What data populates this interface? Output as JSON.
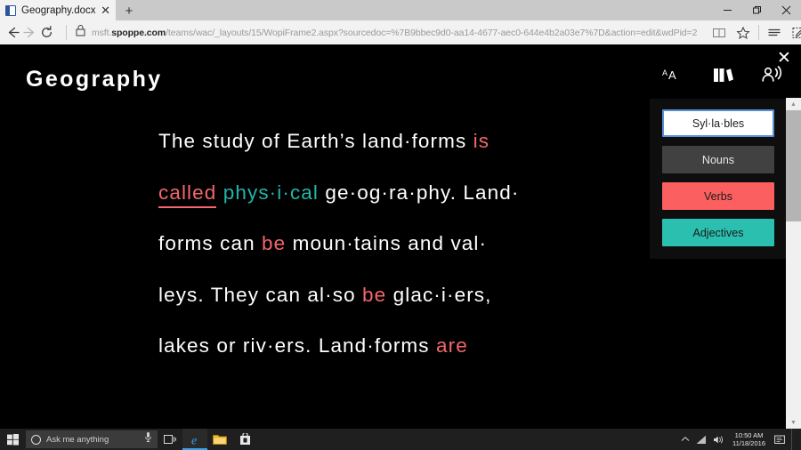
{
  "browser": {
    "tab": {
      "title": "Geography.docx",
      "favicon_icon": "word-doc-icon",
      "close_icon": "close-icon"
    },
    "new_tab_label": "+",
    "window_controls": {
      "minimize": "minimize-icon",
      "restore": "restore-icon",
      "close": "close-icon"
    },
    "nav": {
      "back_icon": "back-arrow-icon",
      "forward_icon": "forward-arrow-icon",
      "refresh_icon": "refresh-icon",
      "lock_icon": "lock-icon"
    },
    "address": {
      "prefix": "msft.",
      "domain": "spoppe.com",
      "path": "/teams/wac/_layouts/15/WopiFrame2.aspx?sourcedoc=%7B9bbec9d0-aa14-4677-aec0-644e4b2a03e7%7D&action=edit&wdPid=2"
    },
    "toolbar_icons": [
      "reading-view-icon",
      "favorites-star-icon",
      "reading-list-icon",
      "web-notes-icon",
      "share-icon",
      "office-icon",
      "more-icon"
    ]
  },
  "reader": {
    "close_label": "✕",
    "title": "Geography",
    "lines": [
      {
        "id": 1,
        "parts": [
          {
            "text": "The study of Earth’s land·forms ",
            "kind": "plain"
          },
          {
            "text": "is",
            "kind": "verb"
          }
        ]
      },
      {
        "id": 2,
        "parts": [
          {
            "text": "called",
            "kind": "verb-selected"
          },
          {
            "text": " ",
            "kind": "plain"
          },
          {
            "text": "phys·i·cal",
            "kind": "adjective"
          },
          {
            "text": " ge·og·ra·phy. Land·",
            "kind": "plain"
          }
        ]
      },
      {
        "id": 3,
        "parts": [
          {
            "text": "forms can ",
            "kind": "plain"
          },
          {
            "text": "be",
            "kind": "verb"
          },
          {
            "text": " moun·tains and val·",
            "kind": "plain"
          }
        ]
      },
      {
        "id": 4,
        "parts": [
          {
            "text": "leys. They can al·so ",
            "kind": "plain"
          },
          {
            "text": "be",
            "kind": "verb"
          },
          {
            "text": " glac·i·ers,",
            "kind": "plain"
          }
        ]
      },
      {
        "id": 5,
        "parts": [
          {
            "text": "lakes or riv·ers. Land·forms ",
            "kind": "plain"
          },
          {
            "text": "are",
            "kind": "verb"
          }
        ]
      }
    ],
    "play_button_icon": "play-icon",
    "tool_icons": [
      {
        "name": "text-size-icon",
        "glyph": "AA"
      },
      {
        "name": "grammar-tools-icon",
        "glyph": "books"
      },
      {
        "name": "read-aloud-icon",
        "glyph": "person-speaking"
      }
    ],
    "options": [
      {
        "label": "Syl·la·bles",
        "state": "selected",
        "color": "#ffffff"
      },
      {
        "label": "Nouns",
        "state": "off",
        "color": "#414141"
      },
      {
        "label": "Verbs",
        "state": "on",
        "color": "#fb5f5f"
      },
      {
        "label": "Adjectives",
        "state": "on",
        "color": "#2bbfb0"
      }
    ],
    "scrollbar": {
      "up_icon": "scroll-up-icon",
      "down_icon": "scroll-down-icon"
    }
  },
  "taskbar": {
    "start_icon": "windows-start-icon",
    "search_placeholder": "Ask me anything",
    "mic_icon": "microphone-icon",
    "task_view_icon": "task-view-icon",
    "apps": [
      {
        "name": "edge",
        "label": "e"
      },
      {
        "name": "file-explorer",
        "label": ""
      },
      {
        "name": "store",
        "label": ""
      }
    ],
    "tray": {
      "chevron_icon": "show-hidden-icons-icon",
      "network_icon": "network-icon",
      "volume_icon": "volume-icon",
      "time": "10:50 AM",
      "date": "11/18/2016",
      "action_center_icon": "action-center-icon"
    }
  },
  "colors": {
    "verb": "#f4666b",
    "adjective": "#23b5a8",
    "accent_blue": "#3aa0e8",
    "stage_bg": "#000000"
  }
}
